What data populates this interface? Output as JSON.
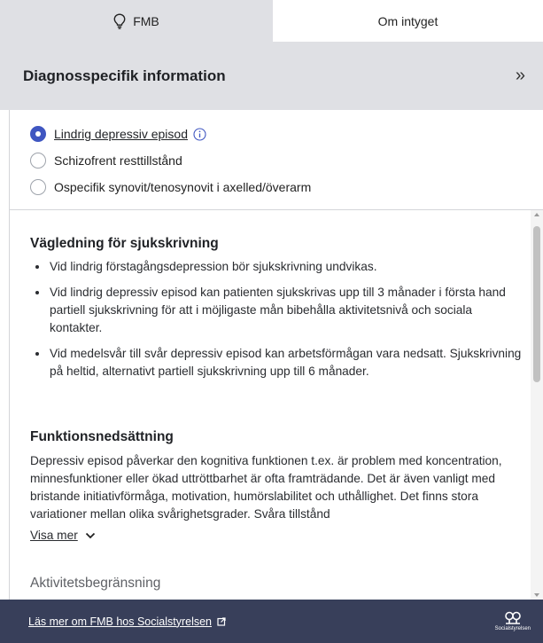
{
  "tabs": [
    {
      "label": "FMB",
      "icon": "lightbulb-icon",
      "active": true
    },
    {
      "label": "Om intyget",
      "active": false
    }
  ],
  "header": {
    "title": "Diagnosspecifik information",
    "collapse_symbol": "»"
  },
  "diagnoses": [
    {
      "label": "Lindrig depressiv episod",
      "selected": true,
      "has_info": true
    },
    {
      "label": "Schizofrent resttillstånd",
      "selected": false
    },
    {
      "label": "Ospecifik synovit/tenosynovit i axelled/överarm",
      "selected": false
    }
  ],
  "guidance": {
    "title": "Vägledning för sjukskrivning",
    "bullets": [
      "Vid lindrig förstagångsdepression bör sjukskrivning undvikas.",
      "Vid lindrig depressiv episod kan patienten sjukskrivas upp till 3 månader i första hand partiell sjukskrivning för att i möjligaste mån bibehålla aktivitetsnivå och sociala kontakter.",
      "Vid medelsvår till svår depressiv episod kan arbetsförmågan vara nedsatt. Sjukskrivning på heltid, alternativt partiell sjukskrivning upp till 6 månader."
    ]
  },
  "function": {
    "title": "Funktionsnedsättning",
    "text": "Depressiv episod påverkar den kognitiva funktionen t.ex. är problem med koncentration, minnesfunktioner eller ökad uttröttbarhet är ofta framträdande. Det är även vanligt med bristande initiativförmåga, motivation, humörslabilitet och uthållighet. Det finns stora variationer mellan olika svårighetsgrader. Svåra tillstånd",
    "show_more": "Visa mer"
  },
  "activity": {
    "title": "Aktivitetsbegränsning"
  },
  "footer": {
    "link": "Läs mer om FMB hos Socialstyrelsen",
    "logo_text": "Socialstyrelsen"
  },
  "colors": {
    "accent": "#3f56c1",
    "header_bg": "#dfe0e4",
    "footer_bg": "#383f5a"
  }
}
